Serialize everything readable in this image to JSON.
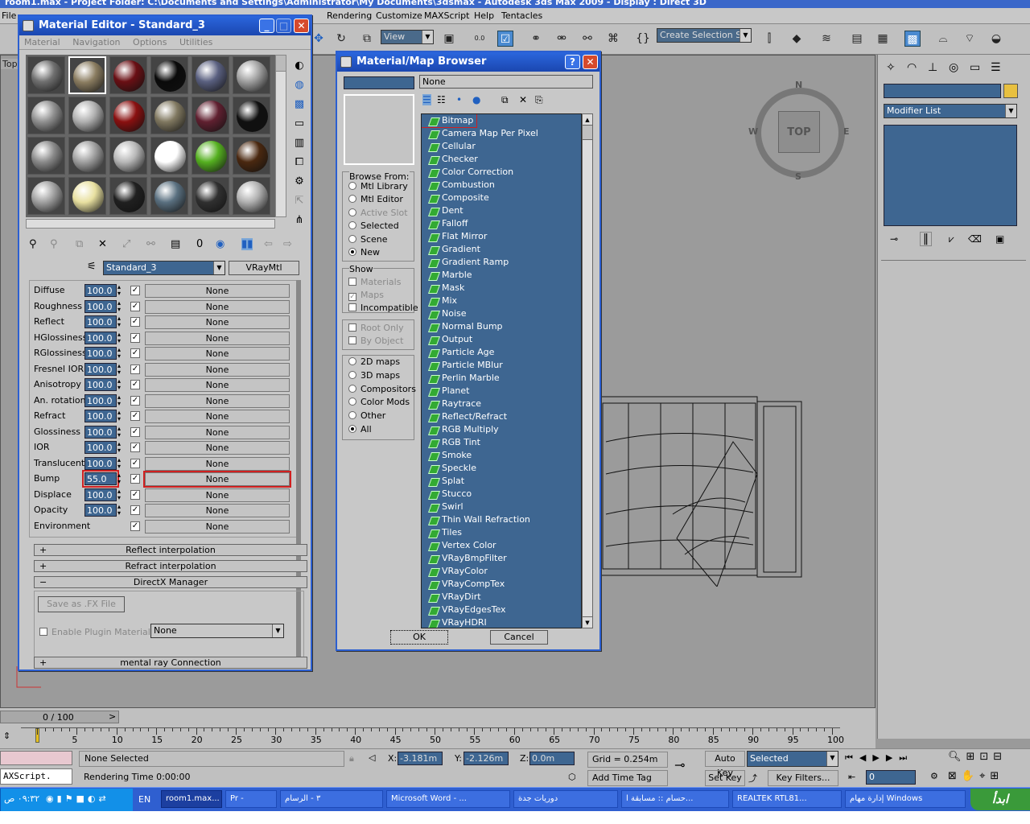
{
  "app": {
    "title": "room1.max - Project Folder: C:\\Documents and Settings\\Administrator\\My Documents\\3dsmax - Autodesk 3ds Max 2009 - Display : Direct 3D"
  },
  "menubar": {
    "items": [
      "File",
      "Rendering",
      "Customize",
      "MAXScript",
      "Help",
      "Tentacles"
    ]
  },
  "toolbar": {
    "view_combo": "View",
    "selection_set": "Create Selection Se",
    "snap_label": "0.0"
  },
  "viewport": {
    "label": "Top",
    "viewcube_face": "TOP",
    "compass": {
      "n": "N",
      "w": "W",
      "e": "E",
      "s": "S"
    }
  },
  "cmdpanel": {
    "modifier_list": "Modifier List"
  },
  "material_editor": {
    "title": "Material Editor - Standard_3",
    "menu": [
      "Material",
      "Navigation",
      "Options",
      "Utilities"
    ],
    "material_name": "Standard_3",
    "material_type": "VRayMtl",
    "slot_colors": [
      [
        "#707070",
        "#8a7c60",
        "#6a0f14",
        "#0a0a0a",
        "#5a6080",
        "#a0a0a0"
      ],
      [
        "#909090",
        "#b0b0b0",
        "#8a1010",
        "#807860",
        "#602030",
        "#101010"
      ],
      [
        "#8a8a8a",
        "#a0a0a0",
        "#b8b8b8",
        "#ffffff",
        "#55b020",
        "#4a2810"
      ],
      [
        "#a0a0a0",
        "#e8e0a0",
        "#202020",
        "#5a7080",
        "#303030",
        "#b0b0b0"
      ]
    ],
    "params": [
      {
        "label": "Diffuse",
        "value": "100.0",
        "checked": true,
        "map": "None"
      },
      {
        "label": "Roughness",
        "value": "100.0",
        "checked": true,
        "map": "None"
      },
      {
        "label": "Reflect",
        "value": "100.0",
        "checked": true,
        "map": "None"
      },
      {
        "label": "HGlossiness",
        "value": "100.0",
        "checked": true,
        "map": "None"
      },
      {
        "label": "RGlossiness",
        "value": "100.0",
        "checked": true,
        "map": "None"
      },
      {
        "label": "Fresnel IOR",
        "value": "100.0",
        "checked": true,
        "map": "None"
      },
      {
        "label": "Anisotropy",
        "value": "100.0",
        "checked": true,
        "map": "None"
      },
      {
        "label": "An. rotation",
        "value": "100.0",
        "checked": true,
        "map": "None"
      },
      {
        "label": "Refract",
        "value": "100.0",
        "checked": true,
        "map": "None"
      },
      {
        "label": "Glossiness",
        "value": "100.0",
        "checked": true,
        "map": "None"
      },
      {
        "label": "IOR",
        "value": "100.0",
        "checked": true,
        "map": "None"
      },
      {
        "label": "Translucent",
        "value": "100.0",
        "checked": true,
        "map": "None"
      },
      {
        "label": "Bump",
        "value": "55.0",
        "checked": true,
        "map": "None",
        "highlight": true
      },
      {
        "label": "Displace",
        "value": "100.0",
        "checked": true,
        "map": "None"
      },
      {
        "label": "Opacity",
        "value": "100.0",
        "checked": true,
        "map": "None"
      },
      {
        "label": "Environment",
        "value": "",
        "checked": true,
        "map": "None"
      }
    ],
    "rollouts": {
      "reflect_interp": "Reflect interpolation",
      "refract_interp": "Refract interpolation",
      "directx": "DirectX Manager",
      "mentalray": "mental ray Connection"
    },
    "save_fx": "Save as .FX File",
    "enable_plugin": "Enable Plugin Material",
    "plugin_value": "None"
  },
  "browser": {
    "title": "Material/Map Browser",
    "name_field": "None",
    "browse_from_label": "Browse From:",
    "browse_from": [
      {
        "label": "Mtl Library",
        "on": false,
        "enabled": true
      },
      {
        "label": "Mtl Editor",
        "on": false,
        "enabled": true
      },
      {
        "label": "Active Slot",
        "on": false,
        "enabled": false
      },
      {
        "label": "Selected",
        "on": false,
        "enabled": true
      },
      {
        "label": "Scene",
        "on": false,
        "enabled": true
      },
      {
        "label": "New",
        "on": true,
        "enabled": true
      }
    ],
    "show_label": "Show",
    "show": [
      {
        "label": "Materials",
        "checked": false,
        "enabled": false
      },
      {
        "label": "Maps",
        "checked": true,
        "enabled": false
      },
      {
        "label": "Incompatible",
        "checked": false,
        "enabled": true
      }
    ],
    "root": [
      {
        "label": "Root Only",
        "enabled": false
      },
      {
        "label": "By Object",
        "enabled": false
      }
    ],
    "map_types": [
      {
        "label": "2D maps",
        "on": false
      },
      {
        "label": "3D maps",
        "on": false
      },
      {
        "label": "Compositors",
        "on": false
      },
      {
        "label": "Color Mods",
        "on": false
      },
      {
        "label": "Other",
        "on": false
      },
      {
        "label": "All",
        "on": true
      }
    ],
    "maps": [
      "Bitmap",
      "Camera Map Per Pixel",
      "Cellular",
      "Checker",
      "Color Correction",
      "Combustion",
      "Composite",
      "Dent",
      "Falloff",
      "Flat Mirror",
      "Gradient",
      "Gradient Ramp",
      "Marble",
      "Mask",
      "Mix",
      "Noise",
      "Normal Bump",
      "Output",
      "Particle Age",
      "Particle MBlur",
      "Perlin Marble",
      "Planet",
      "Raytrace",
      "Reflect/Refract",
      "RGB Multiply",
      "RGB Tint",
      "Smoke",
      "Speckle",
      "Splat",
      "Stucco",
      "Swirl",
      "Thin Wall Refraction",
      "Tiles",
      "Vertex Color",
      "VRayBmpFilter",
      "VRayColor",
      "VRayCompTex",
      "VRayDirt",
      "VRayEdgesTex",
      "VRayHDRI"
    ],
    "ok": "OK",
    "cancel": "Cancel"
  },
  "timeline": {
    "frame_counter": "0 / 100",
    "ticks": [
      "5",
      "10",
      "15",
      "20",
      "25",
      "30",
      "35",
      "40",
      "45",
      "50",
      "55",
      "60",
      "65",
      "70",
      "75",
      "80",
      "85",
      "90",
      "95",
      "100"
    ]
  },
  "status": {
    "maxscript": "AXScript.",
    "selection": "None Selected",
    "rendering_time": "Rendering Time  0:00:00",
    "x_label": "X:",
    "x": "-3.181m",
    "y_label": "Y:",
    "y": "-2.126m",
    "z_label": "Z:",
    "z": "0.0m",
    "grid": "Grid = 0.254m",
    "add_time_tag": "Add Time Tag",
    "auto_key": "Auto Key",
    "selected": "Selected",
    "set_key": "Set Key",
    "key_filters": "Key Filters...",
    "frame": "0"
  },
  "taskbar": {
    "start": "ابدأ",
    "tasks": [
      "إدارة مهام Windows",
      "REALTEK RTL81...",
      "حسام :: مسابقة ا...",
      "دوريات جدة",
      "Microsoft Word - ...",
      "٣ - الرسام",
      "Pr - ",
      "room1.max..."
    ],
    "lang": "EN",
    "clock": "٠٩:٣٢ ص"
  }
}
